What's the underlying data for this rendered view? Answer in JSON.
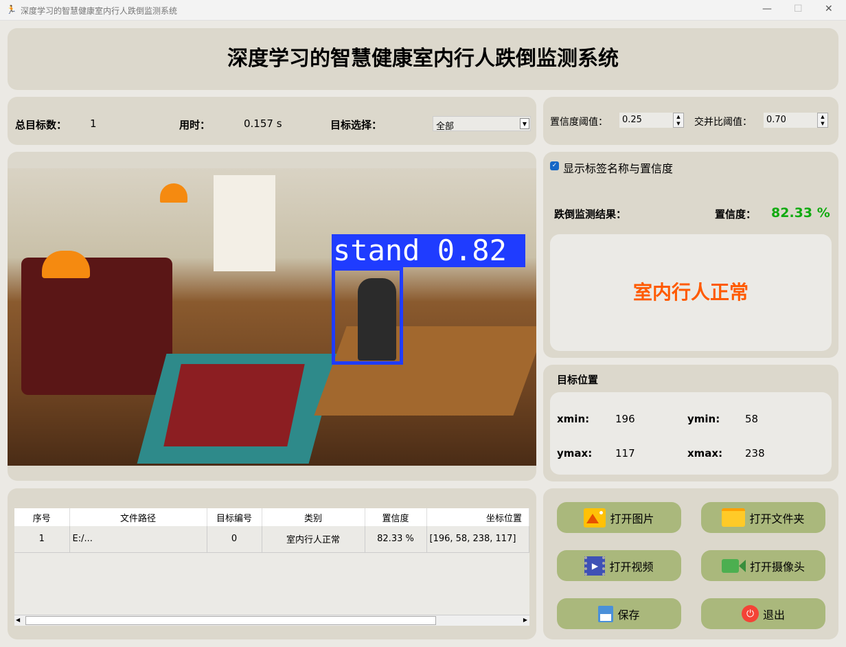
{
  "window": {
    "title": "深度学习的智慧健康室内行人跌倒监测系统"
  },
  "header": {
    "title": "深度学习的智慧健康室内行人跌倒监测系统"
  },
  "stats": {
    "total_label": "总目标数：",
    "total_value": "1",
    "time_label": "用时：",
    "time_value": "0.157 s",
    "select_label": "目标选择：",
    "select_value": "全部"
  },
  "thresholds": {
    "conf_label": "置信度阈值：",
    "conf_value": "0.25",
    "iou_label": "交并比阈值：",
    "iou_value": "0.70"
  },
  "detection": {
    "label": "stand 0.82",
    "box_color": "#1f3cff"
  },
  "result": {
    "checkbox_label": "显示标签名称与置信度",
    "checked": true,
    "result_label": "跌倒监测结果：",
    "conf_label": "置信度：",
    "conf_value": "82.33 %",
    "status": "室内行人正常",
    "status_color": "#ff5a00",
    "conf_color": "#10aa10"
  },
  "position": {
    "title": "目标位置",
    "xmin_label": "xmin:",
    "xmin": "196",
    "ymin_label": "ymin:",
    "ymin": "58",
    "ymax_label": "ymax:",
    "ymax": "117",
    "xmax_label": "xmax:",
    "xmax": "238"
  },
  "table": {
    "headers": [
      "序号",
      "文件路径",
      "目标编号",
      "类别",
      "置信度",
      "坐标位置"
    ],
    "rows": [
      [
        "1",
        "E:/...",
        "0",
        "室内行人正常",
        "82.33 %",
        "[196, 58, 238, 117]"
      ]
    ]
  },
  "buttons": {
    "open_image": "打开图片",
    "open_folder": "打开文件夹",
    "open_video": "打开视频",
    "open_camera": "打开摄像头",
    "save": "保存",
    "exit": "退出"
  }
}
